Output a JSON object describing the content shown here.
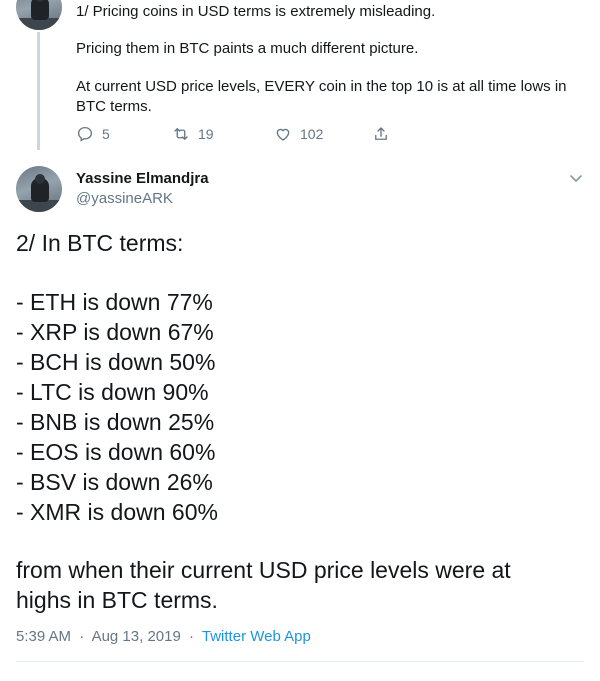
{
  "parent_tweet": {
    "line1": "1/ Pricing coins in USD terms is extremely misleading.",
    "line2": "Pricing them in BTC paints a much different picture.",
    "line3": "At current USD price levels, EVERY coin in the top 10 is at all time lows in BTC terms.",
    "reply_count": "5",
    "retweet_count": "19",
    "like_count": "102",
    "icons": [
      "reply-icon",
      "retweet-icon",
      "like-icon",
      "share-icon"
    ]
  },
  "main_tweet": {
    "author_name": "Yassine Elmandjra",
    "author_handle": "@yassineARK",
    "intro": "2/ In BTC terms:",
    "items": [
      "- ETH is down 77%",
      "- XRP is down 67%",
      "- BCH is down 50%",
      "- LTC is down 90%",
      "- BNB is down 25%",
      "- EOS is down 60%",
      "- BSV is down 26%",
      "- XMR is down 60%"
    ],
    "outro_line1": "from when their current USD price levels were at",
    "outro_line2": "highs in BTC terms.",
    "time": "5:39 AM",
    "separator": "·",
    "date": "Aug 13, 2019",
    "source": "Twitter Web App"
  },
  "colors": {
    "text": "#14171a",
    "muted": "#657786",
    "link": "#1b95e0",
    "divider": "#e6ecf0",
    "thread_line": "#ccd6dd"
  }
}
